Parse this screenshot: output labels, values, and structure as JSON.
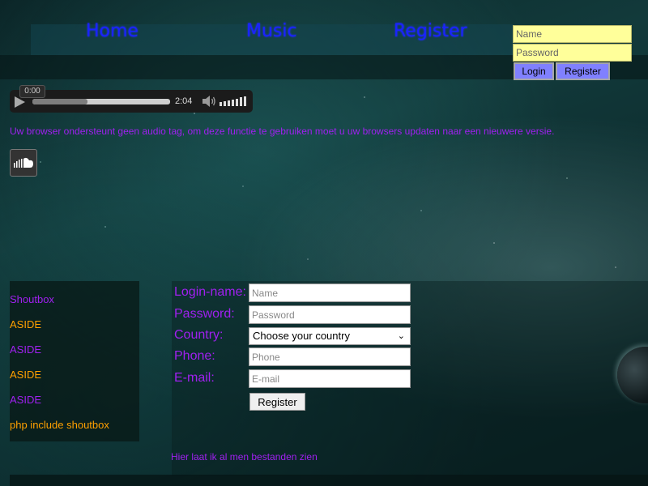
{
  "nav": {
    "home": "Home",
    "music": "Music",
    "register": "Register"
  },
  "login": {
    "name_placeholder": "Name",
    "password_placeholder": "Password",
    "login_label": "Login",
    "register_label": "Register"
  },
  "audio": {
    "current_time": "0:00",
    "duration": "2:04",
    "buffered_fraction": 0.4
  },
  "warning_text": "Uw browser ondersteunt geen audio tag, om deze functie te gebruiken moet u uw browsers updaten naar een nieuwere versie.",
  "soundcloud": {
    "icon": "soundcloud-icon"
  },
  "aside": {
    "items": [
      {
        "label": "Shoutbox",
        "color": "#a020f0"
      },
      {
        "label": "ASIDE",
        "color": "#ffa000"
      },
      {
        "label": "ASIDE",
        "color": "#a020f0"
      },
      {
        "label": "ASIDE",
        "color": "#ffa000"
      },
      {
        "label": "ASIDE",
        "color": "#a020f0"
      },
      {
        "label": "php include shoutbox",
        "color": "#ffa000"
      }
    ]
  },
  "form": {
    "login_name_label": "Login-name:",
    "login_name_placeholder": "Name",
    "password_label": "Password:",
    "password_placeholder": "Password",
    "country_label": "Country:",
    "country_selected": "Choose your country",
    "phone_label": "Phone:",
    "phone_placeholder": "Phone",
    "email_label": "E-mail:",
    "email_placeholder": "E-mail",
    "register_label": "Register"
  },
  "files_text": "Hier laat ik al men bestanden zien",
  "colors": {
    "nav_link": "#1a22ff",
    "accent_purple": "#a020f0",
    "accent_orange": "#ffa000",
    "login_input_bg": "#ffff9a",
    "login_button_bg": "#8080ff"
  }
}
